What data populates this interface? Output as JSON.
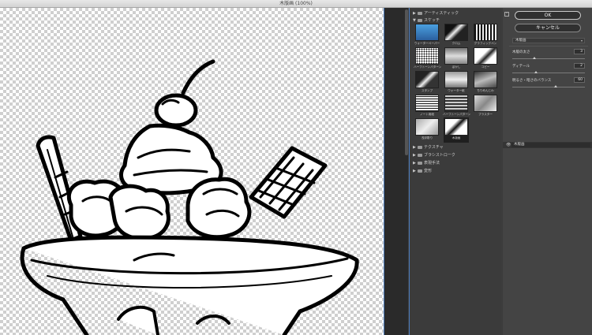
{
  "window": {
    "title": "木版画 (100%)"
  },
  "gallery": {
    "categories_top": [
      {
        "label": "アーティスティック",
        "expanded": false
      },
      {
        "label": "スケッチ",
        "expanded": true
      }
    ],
    "thumbnails": [
      {
        "label": "ウォーターペーパー",
        "selected": false
      },
      {
        "label": "クロム",
        "selected": false
      },
      {
        "label": "グラフィックペン",
        "selected": false
      },
      {
        "label": "ハーフトーンパターン",
        "selected": false
      },
      {
        "label": "ぼかし",
        "selected": false
      },
      {
        "label": "コピー",
        "selected": false
      },
      {
        "label": "スタンプ",
        "selected": false
      },
      {
        "label": "ウォーター紙",
        "selected": false
      },
      {
        "label": "ちりめんじわ",
        "selected": false
      },
      {
        "label": "ノート用紙",
        "selected": false
      },
      {
        "label": "ハーフトーンパターン",
        "selected": false
      },
      {
        "label": "プラスター",
        "selected": false
      },
      {
        "label": "浅浮彫り",
        "selected": false
      },
      {
        "label": "木版画",
        "selected": true
      }
    ],
    "categories_bottom": [
      {
        "label": "テクスチャ",
        "expanded": false
      },
      {
        "label": "ブラシストローク",
        "expanded": false
      },
      {
        "label": "表現手法",
        "expanded": false
      },
      {
        "label": "変形",
        "expanded": false
      }
    ]
  },
  "settings": {
    "ok_label": "OK",
    "cancel_label": "キャンセル",
    "toggle_glyph": "⌃",
    "filter_name": "木版画",
    "params": [
      {
        "label": "木版の太さ",
        "value": "3",
        "fraction": 0.3
      },
      {
        "label": "ディテール",
        "value": "2",
        "fraction": 0.33
      },
      {
        "label": "明るさ・暗さのバランス",
        "value": "60",
        "fraction": 0.6
      }
    ],
    "layer_name": "木版画",
    "eye_glyph": "👁"
  }
}
